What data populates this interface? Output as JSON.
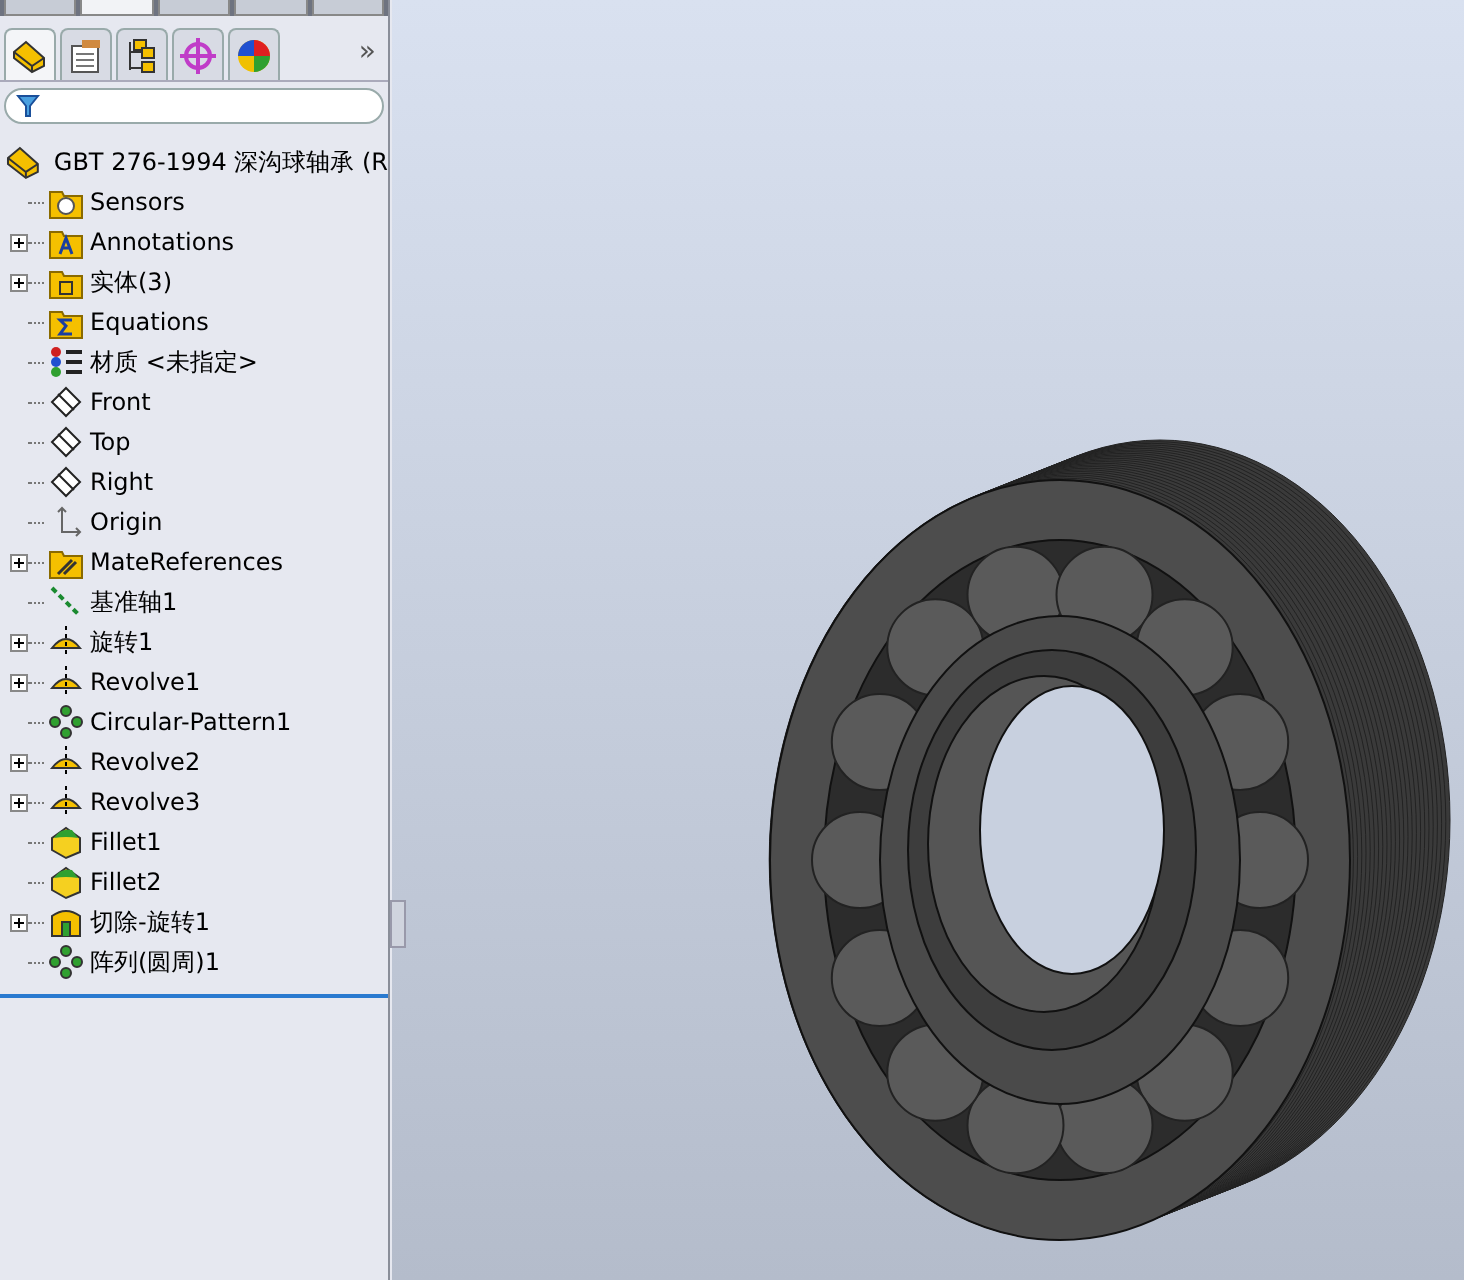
{
  "command_tabs": [
    {
      "selected": false
    },
    {
      "selected": true
    },
    {
      "selected": false
    },
    {
      "selected": false
    },
    {
      "selected": false
    }
  ],
  "panel_tabs": [
    {
      "kind": "feature-tree",
      "selected": true
    },
    {
      "kind": "property",
      "selected": false
    },
    {
      "kind": "configuration",
      "selected": false
    },
    {
      "kind": "dimxpert",
      "selected": false
    },
    {
      "kind": "display",
      "selected": false
    }
  ],
  "more_tabs": "»",
  "tree": {
    "label": "GBT 276-1994 深沟球轴承  (R",
    "children": [
      {
        "label": "Sensors",
        "kind": "sensors",
        "expandable": false
      },
      {
        "label": "Annotations",
        "kind": "annotations",
        "expandable": true
      },
      {
        "label": "实体(3)",
        "kind": "solids",
        "expandable": true
      },
      {
        "label": "Equations",
        "kind": "equations",
        "expandable": false
      },
      {
        "label": "材质 <未指定>",
        "kind": "material",
        "expandable": false
      },
      {
        "label": "Front",
        "kind": "plane",
        "expandable": false
      },
      {
        "label": "Top",
        "kind": "plane",
        "expandable": false
      },
      {
        "label": "Right",
        "kind": "plane",
        "expandable": false
      },
      {
        "label": "Origin",
        "kind": "origin",
        "expandable": false
      },
      {
        "label": "MateReferences",
        "kind": "mates",
        "expandable": true
      },
      {
        "label": "基准轴1",
        "kind": "axis",
        "expandable": false
      },
      {
        "label": "旋转1",
        "kind": "revolve",
        "expandable": true
      },
      {
        "label": "Revolve1",
        "kind": "revolve",
        "expandable": true
      },
      {
        "label": "Circular-Pattern1",
        "kind": "pattern",
        "expandable": false
      },
      {
        "label": "Revolve2",
        "kind": "revolve",
        "expandable": true
      },
      {
        "label": "Revolve3",
        "kind": "revolve",
        "expandable": true
      },
      {
        "label": "Fillet1",
        "kind": "fillet",
        "expandable": false
      },
      {
        "label": "Fillet2",
        "kind": "fillet",
        "expandable": false
      },
      {
        "label": "切除-旋转1",
        "kind": "cut",
        "expandable": true
      },
      {
        "label": "阵列(圆周)1",
        "kind": "pattern",
        "expandable": false
      }
    ]
  }
}
